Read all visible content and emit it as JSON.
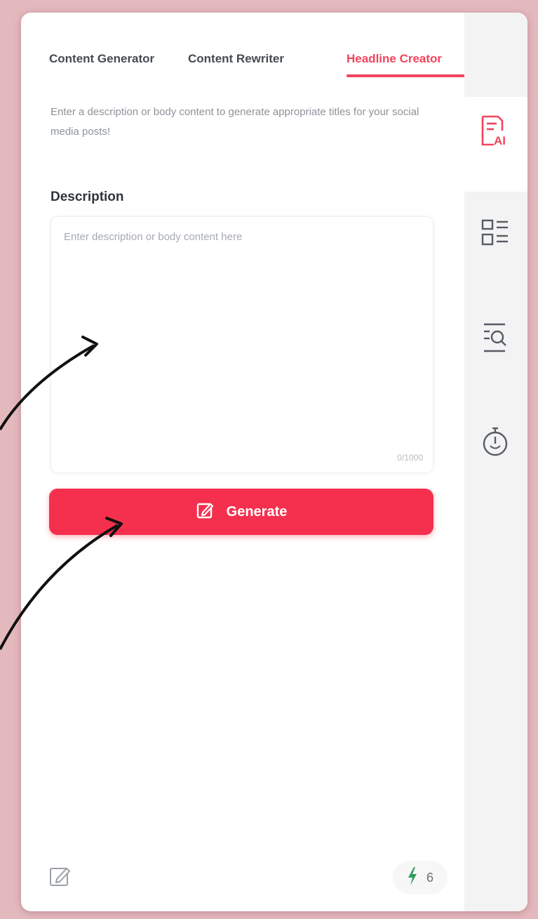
{
  "tabs": [
    {
      "label": "Content Generator",
      "active": false
    },
    {
      "label": "Content Rewriter",
      "active": false
    },
    {
      "label": "Headline Creator",
      "active": true
    }
  ],
  "intro_text": "Enter a description or body content to generate appropriate titles for your social media posts!",
  "description": {
    "label": "Description",
    "placeholder": "Enter description or body content here",
    "counter": "0/1000"
  },
  "generate_button": {
    "label": "Generate"
  },
  "credits": {
    "count": "6"
  },
  "sidebar": {
    "icons": [
      "ai-writer-icon",
      "layout-list-icon",
      "search-list-icon",
      "timer-icon"
    ]
  },
  "colors": {
    "accent": "#f5304e",
    "background": "#e3b9be",
    "credit_icon": "#2e9e5a"
  }
}
